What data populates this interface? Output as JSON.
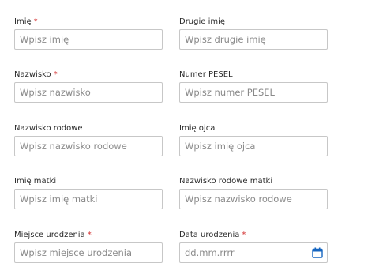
{
  "form": {
    "required_marker": "*",
    "fields": [
      {
        "label": "Imię",
        "required": true,
        "placeholder": "Wpisz imię"
      },
      {
        "label": "Drugie imię",
        "required": false,
        "placeholder": "Wpisz drugie imię"
      },
      {
        "label": "Nazwisko",
        "required": true,
        "placeholder": "Wpisz nazwisko"
      },
      {
        "label": "Numer PESEL",
        "required": false,
        "placeholder": "Wpisz numer PESEL"
      },
      {
        "label": "Nazwisko rodowe",
        "required": false,
        "placeholder": "Wpisz nazwisko rodowe"
      },
      {
        "label": "Imię ojca",
        "required": false,
        "placeholder": "Wpisz imię ojca"
      },
      {
        "label": "Imię matki",
        "required": false,
        "placeholder": "Wpisz imię matki"
      },
      {
        "label": "Nazwisko rodowe matki",
        "required": false,
        "placeholder": "Wpisz nazwisko rodowe"
      },
      {
        "label": "Miejsce urodzenia",
        "required": true,
        "placeholder": "Wpisz miejsce urodzenia"
      },
      {
        "label": "Data urodzenia",
        "required": true,
        "placeholder": "dd.mm.rrrr",
        "icon": "calendar-icon"
      }
    ]
  },
  "colors": {
    "required": "#d32f2f",
    "icon": "#1565c0",
    "border": "#c7c7c7"
  }
}
